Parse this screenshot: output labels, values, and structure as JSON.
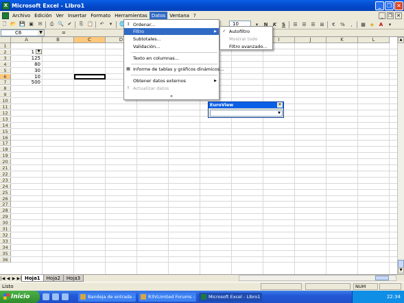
{
  "window": {
    "title": "Microsoft Excel - Libro1",
    "app_icon": "X"
  },
  "menubar": {
    "items": [
      "Archivo",
      "Edición",
      "Ver",
      "Insertar",
      "Formato",
      "Herramientas",
      "Datos",
      "Ventana",
      "?"
    ],
    "active": "Datos"
  },
  "toolbar": {
    "font_size": "10"
  },
  "formula_bar": {
    "name_box": "C6",
    "fx": "="
  },
  "grid": {
    "columns": [
      "A",
      "B",
      "C",
      "D",
      "E",
      "F",
      "G",
      "H",
      "I",
      "J",
      "K",
      "L"
    ],
    "selected_column": "C",
    "rows": [
      "1",
      "2",
      "3",
      "4",
      "5",
      "6",
      "7",
      "8",
      "9",
      "10",
      "11",
      "12",
      "13",
      "14",
      "15",
      "16",
      "17",
      "18",
      "19",
      "20",
      "21",
      "22",
      "23",
      "24",
      "25",
      "26",
      "27",
      "28",
      "29",
      "30",
      "31",
      "32",
      "33",
      "34",
      "35",
      "36"
    ],
    "selected_row": "6",
    "cells": [
      {
        "ref": "A2",
        "value": "1"
      },
      {
        "ref": "A3",
        "value": "125"
      },
      {
        "ref": "A4",
        "value": "80"
      },
      {
        "ref": "A5",
        "value": "30"
      },
      {
        "ref": "A6",
        "value": "10"
      },
      {
        "ref": "A7",
        "value": "500"
      }
    ]
  },
  "datos_menu": {
    "items": [
      {
        "label": "Ordenar...",
        "icon": "sort-icon"
      },
      {
        "label": "Filtro",
        "submenu": true,
        "highlighted": true
      },
      {
        "label": "Subtotales..."
      },
      {
        "label": "Validación..."
      },
      {
        "label": "Texto en columnas..."
      },
      {
        "label": "Informe de tablas y gráficos dinámicos...",
        "icon": "pivot-icon"
      },
      {
        "label": "Obtener datos externos",
        "submenu": true
      },
      {
        "label": "Actualizar datos",
        "disabled": true,
        "icon": "refresh-icon"
      },
      {
        "label": "»"
      }
    ]
  },
  "filtro_submenu": {
    "items": [
      {
        "label": "Autofiltro",
        "checked": true
      },
      {
        "label": "Mostrar todo",
        "disabled": true
      },
      {
        "label": "Filtro avanzado..."
      }
    ]
  },
  "euroview": {
    "title": "EuroView"
  },
  "sheets": {
    "tabs": [
      "Hoja1",
      "Hoja2",
      "Hoja3"
    ],
    "active": "Hoja1"
  },
  "status": {
    "text": "Listo",
    "num": "NUM"
  },
  "taskbar": {
    "start": "Inicio",
    "buttons": [
      {
        "label": "Bandeja de entrada - ...",
        "active": false
      },
      {
        "label": "R3VLimited Forums - ...",
        "active": false
      },
      {
        "label": "Microsoft Excel - Libro1",
        "active": true
      }
    ],
    "clock": "22:34"
  }
}
